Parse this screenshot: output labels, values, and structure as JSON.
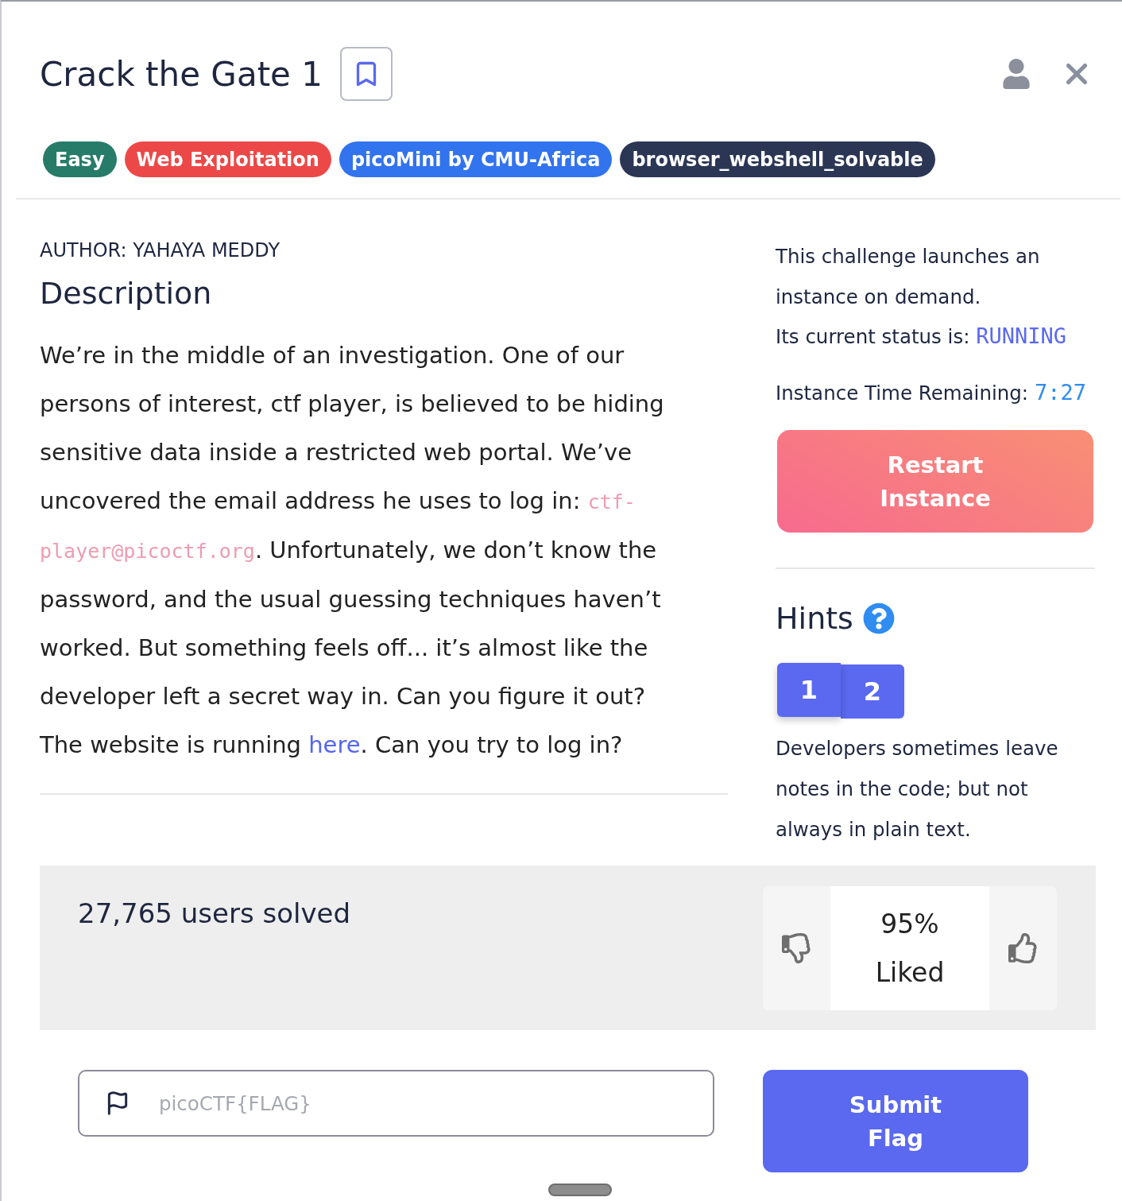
{
  "header": {
    "title": "Crack the Gate 1"
  },
  "tags": [
    {
      "label": "Easy",
      "color": "#277b69"
    },
    {
      "label": "Web Exploitation",
      "color": "#ec4848"
    },
    {
      "label": "picoMini by CMU-Africa",
      "color": "#3273ee"
    },
    {
      "label": "browser_webshell_solvable",
      "color": "#2b3655"
    }
  ],
  "author": "AUTHOR: YAHAYA MEDDY",
  "description": {
    "heading": "Description",
    "segments": [
      {
        "kind": "text",
        "text": "We’re in the middle of an investigation. One of our persons of interest, ctf player, is believed to be hiding sensitive data inside a restricted web portal. We’ve uncovered the email address he uses to log in: "
      },
      {
        "kind": "code",
        "text": "ctf-player@picoctf.org"
      },
      {
        "kind": "text",
        "text": ". Unfortunately, we don’t know the password, and the usual guessing techniques haven’t worked. But something feels off... it’s almost like the developer left a secret way in. Can you figure it out? The website is running "
      },
      {
        "kind": "link",
        "text": "here"
      },
      {
        "kind": "text",
        "text": ". Can you try to log in?"
      }
    ]
  },
  "instance": {
    "intro": "This challenge launches an instance on demand.",
    "status_label": "Its current status is:",
    "status": "RUNNING",
    "time_label": "Instance Time Remaining:",
    "time": "7:27",
    "restart_button": "Restart Instance"
  },
  "hints": {
    "heading": "Hints",
    "tabs": [
      {
        "label": "1",
        "selected": true
      },
      {
        "label": "2",
        "selected": false
      }
    ],
    "text": "Developers sometimes leave notes in the code; but not always in plain text."
  },
  "stats": {
    "solved": "27,765 users solved",
    "rating": "95%",
    "rating_label": "Liked"
  },
  "flag": {
    "placeholder": "picoCTF{FLAG}",
    "submit_button": "Submit Flag"
  }
}
